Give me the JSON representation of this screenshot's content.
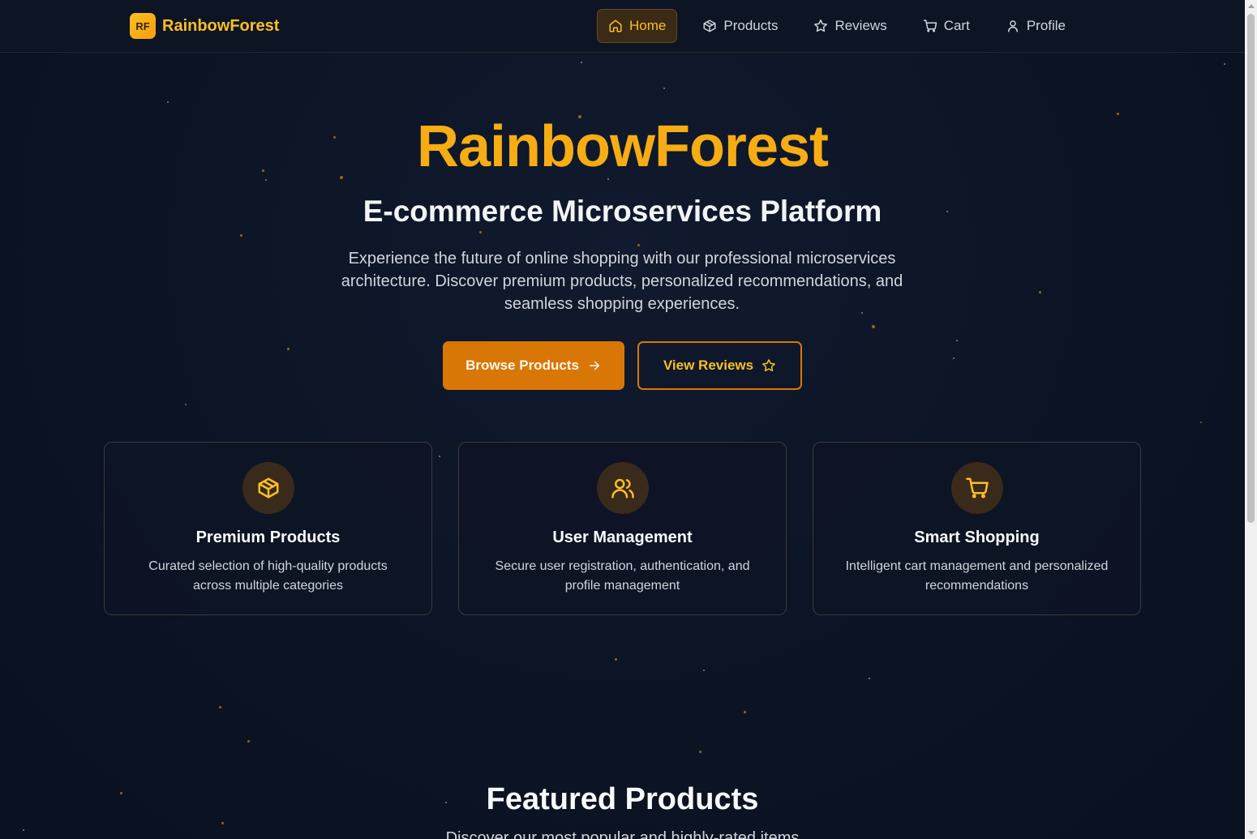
{
  "brand": {
    "badge": "RF",
    "name": "RainbowForest"
  },
  "nav": {
    "items": [
      {
        "label": "Home",
        "icon": "home-icon",
        "active": true
      },
      {
        "label": "Products",
        "icon": "package-icon",
        "active": false
      },
      {
        "label": "Reviews",
        "icon": "star-icon",
        "active": false
      },
      {
        "label": "Cart",
        "icon": "cart-icon",
        "active": false
      },
      {
        "label": "Profile",
        "icon": "user-icon",
        "active": false
      }
    ]
  },
  "hero": {
    "title": "RainbowForest",
    "subtitle": "E-commerce Microservices Platform",
    "description": "Experience the future of online shopping with our professional microservices architecture. Discover premium products, personalized recommendations, and seamless shopping experiences.",
    "primary_button": "Browse Products",
    "secondary_button": "View Reviews"
  },
  "features": [
    {
      "icon": "package-icon",
      "title": "Premium Products",
      "text": "Curated selection of high-quality products across multiple categories"
    },
    {
      "icon": "users-icon",
      "title": "User Management",
      "text": "Secure user registration, authentication, and profile management"
    },
    {
      "icon": "cart-icon",
      "title": "Smart Shopping",
      "text": "Intelligent cart management and personalized recommendations"
    }
  ],
  "featured": {
    "title": "Featured Products",
    "subtitle": "Discover our most popular and highly-rated items"
  },
  "colors": {
    "accent": "#fbbf24",
    "primary_button": "#d97706",
    "background": "#0b1220"
  }
}
